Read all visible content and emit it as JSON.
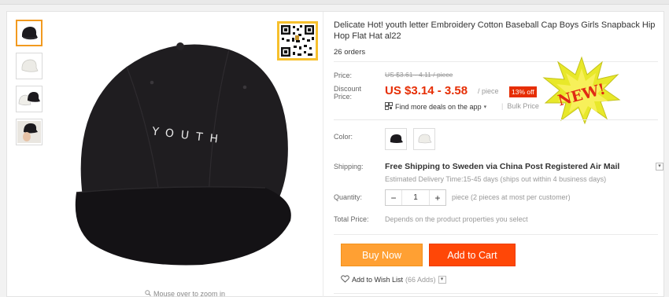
{
  "product": {
    "title": "Delicate Hot! youth letter Embroidery Cotton Baseball Cap Boys Girls Snapback Hip Hop Flat Hat al22",
    "orders": "26 orders",
    "cap_text": "YOUTH",
    "zoom_hint": "Mouse over to zoom in"
  },
  "price": {
    "price_label": "Price:",
    "old_price": "US $3.61 - 4.11 / piece",
    "discount_label": "Discount Price:",
    "new_price": "US $3.14 - 3.58",
    "per_piece": "/ piece",
    "off_badge": "13% off",
    "app_deals": "Find more deals on the app",
    "bulk_price": "Bulk Price",
    "new_badge_text": "NEW!"
  },
  "options": {
    "color_label": "Color:",
    "shipping_label": "Shipping:",
    "shipping_main": "Free Shipping to Sweden via China Post Registered Air Mail",
    "shipping_sub": "Estimated Delivery Time:15-45 days (ships out within 4 business days)",
    "quantity_label": "Quantity:",
    "qty_minus": "−",
    "qty_value": "1",
    "qty_plus": "+",
    "qty_note": "piece (2 pieces at most per customer)",
    "total_label": "Total Price:",
    "total_note": "Depends on the product properties you select"
  },
  "actions": {
    "buy_now": "Buy Now",
    "add_to_cart": "Add to Cart",
    "wishlist": "Add to Wish List",
    "wishlist_count": "(66 Adds)"
  },
  "colors": {
    "price_red": "#e62e04",
    "buy_orange": "#ffa033",
    "cart_red": "#ff4707",
    "active_thumb": "#f29a1f"
  }
}
